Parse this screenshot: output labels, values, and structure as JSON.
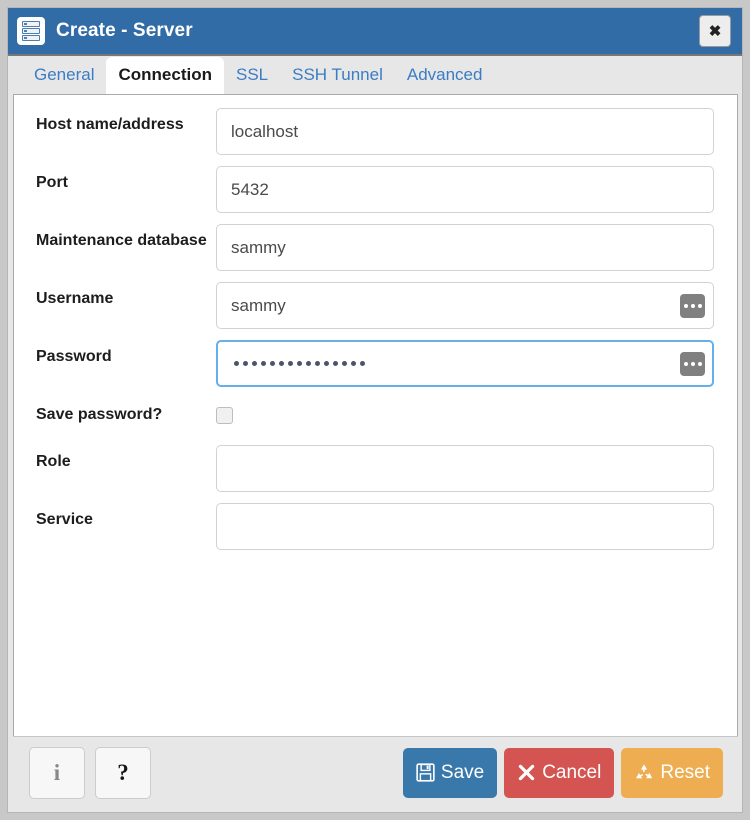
{
  "window": {
    "title": "Create - Server",
    "icon": "server-stack-icon",
    "close_label": "✖",
    "accent_color": "#326ca6"
  },
  "tabs": [
    {
      "label": "General",
      "active": false
    },
    {
      "label": "Connection",
      "active": true
    },
    {
      "label": "SSL",
      "active": false
    },
    {
      "label": "SSH Tunnel",
      "active": false
    },
    {
      "label": "Advanced",
      "active": false
    }
  ],
  "form": {
    "fields": [
      {
        "label": "Host name/address",
        "value": "localhost",
        "placeholder": "",
        "type": "text",
        "addon": false,
        "focused": false
      },
      {
        "label": "Port",
        "value": "5432",
        "placeholder": "",
        "type": "text",
        "addon": false,
        "focused": false
      },
      {
        "label": "Maintenance database",
        "value": "sammy",
        "placeholder": "",
        "type": "text",
        "addon": false,
        "focused": false
      },
      {
        "label": "Username",
        "value": "sammy",
        "placeholder": "",
        "type": "text",
        "addon": true,
        "focused": false
      },
      {
        "label": "Password",
        "value": "",
        "placeholder": "",
        "type": "password",
        "addon": true,
        "focused": true,
        "masked_length": 15
      },
      {
        "label": "Save password?",
        "value": "",
        "placeholder": "",
        "type": "checkbox",
        "addon": false,
        "focused": false,
        "checked": false
      },
      {
        "label": "Role",
        "value": "",
        "placeholder": "",
        "type": "text",
        "addon": false,
        "focused": false
      },
      {
        "label": "Service",
        "value": "",
        "placeholder": "",
        "type": "text",
        "addon": false,
        "focused": false
      }
    ],
    "addon_icon": "ellipsis-icon"
  },
  "footer": {
    "info_label": "i",
    "info_icon": "info-icon",
    "help_label": "?",
    "help_icon": "help-icon",
    "save_label": "Save",
    "save_icon": "floppy-disk-icon",
    "save_color": "#3878ab",
    "cancel_label": "Cancel",
    "cancel_icon": "close-x-icon",
    "cancel_color": "#d35450",
    "reset_label": "Reset",
    "reset_icon": "recycle-icon",
    "reset_color": "#eead51"
  }
}
